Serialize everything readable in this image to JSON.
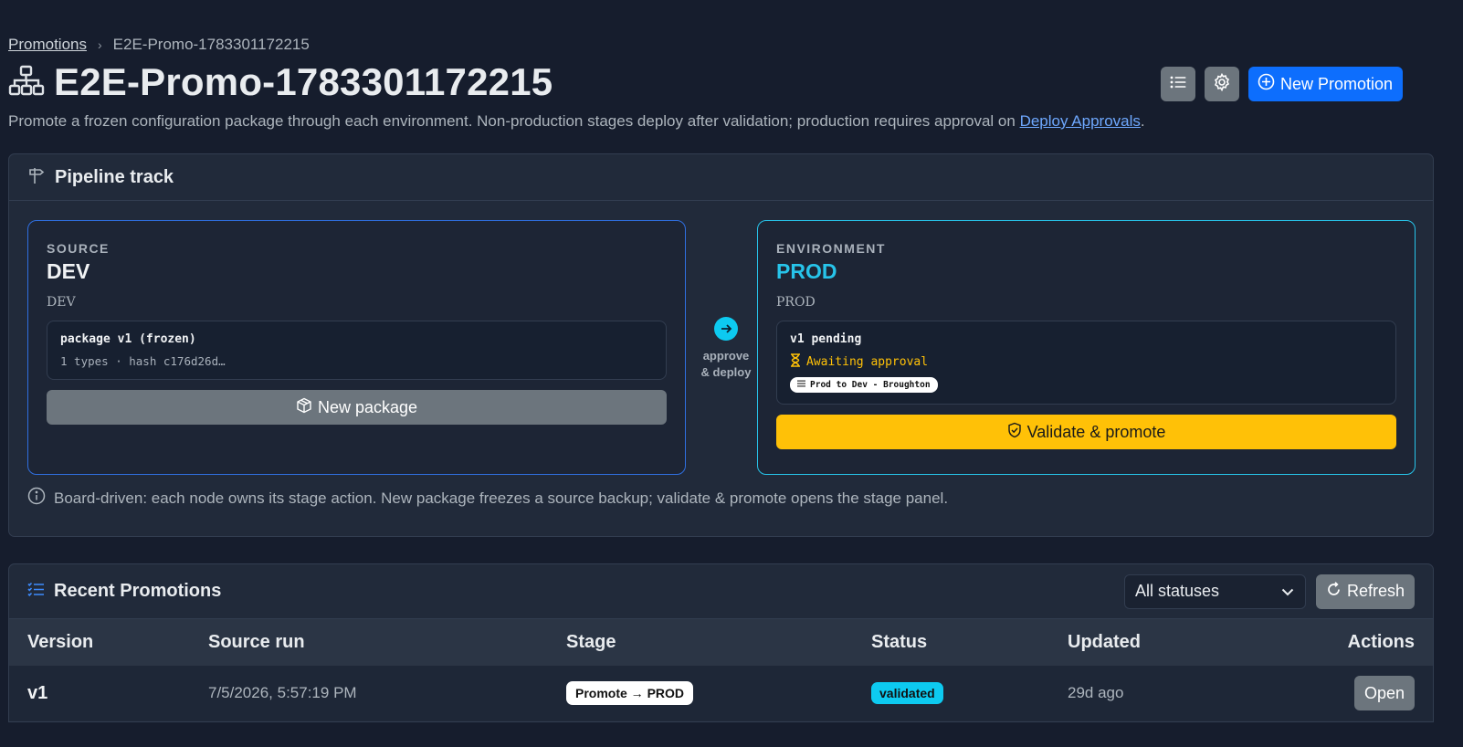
{
  "breadcrumb": {
    "root": "Promotions",
    "current": "E2E-Promo-1783301172215"
  },
  "page": {
    "title": "E2E-Promo-1783301172215",
    "subtitle": "Promote a frozen configuration package through each environment. Non-production stages deploy after validation; production requires approval on ",
    "subtitle_link": "Deploy Approvals",
    "subtitle_end": "."
  },
  "header_actions": {
    "new_promotion": "New Promotion"
  },
  "pipeline": {
    "title": "Pipeline track",
    "source": {
      "kicker": "SOURCE",
      "name": "DEV",
      "sub": "DEV",
      "package_line": "package v1 (frozen)",
      "meta_line": "1 types · hash c176d26d…",
      "button": "New package"
    },
    "connector": {
      "line1": "approve",
      "line2": "& deploy"
    },
    "environment": {
      "kicker": "ENVIRONMENT",
      "name": "PROD",
      "sub": "PROD",
      "version_line": "v1 pending",
      "status_line": "Awaiting approval",
      "tag": "Prod to Dev - Broughton",
      "button": "Validate & promote"
    },
    "hint": "Board-driven: each node owns its stage action. New package freezes a source backup; validate & promote opens the stage panel."
  },
  "recent": {
    "title": "Recent Promotions",
    "filter_value": "All statuses",
    "refresh": "Refresh",
    "columns": [
      "Version",
      "Source run",
      "Stage",
      "Status",
      "Updated",
      "Actions"
    ],
    "rows": [
      {
        "version": "v1",
        "source_run": "7/5/2026, 5:57:19 PM",
        "stage": "Promote → PROD",
        "status": "validated",
        "updated": "29d ago",
        "action": "Open"
      }
    ]
  },
  "colors": {
    "background": "#161d2d",
    "primary": "#0d6efd",
    "info": "#0dcaf0",
    "warning": "#ffc107",
    "secondary": "#6c757d"
  }
}
